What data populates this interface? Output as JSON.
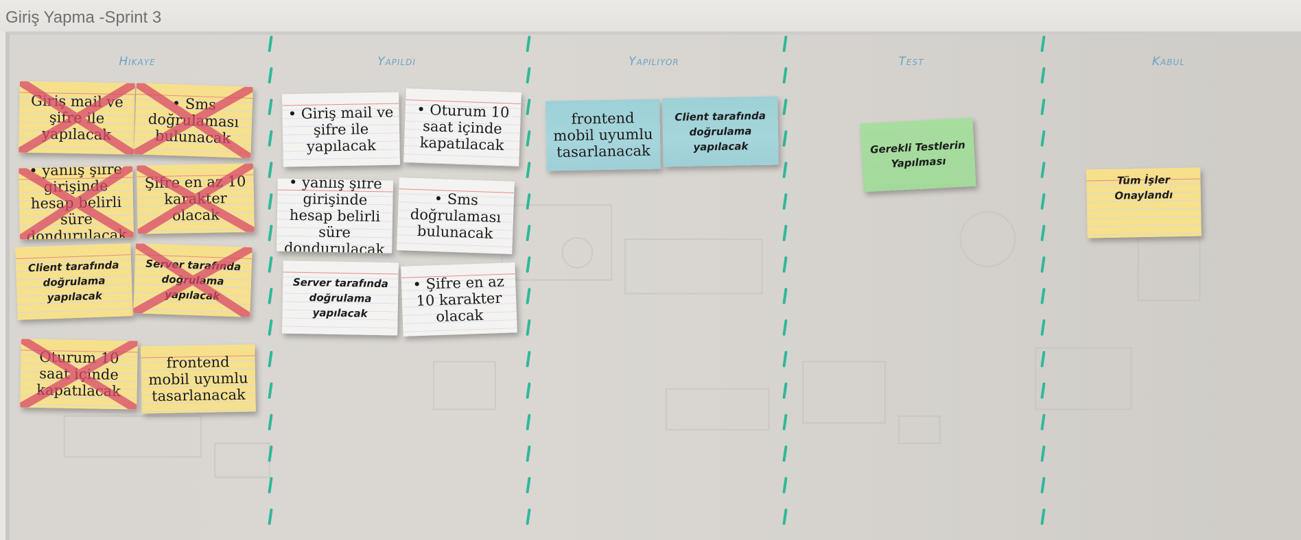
{
  "board": {
    "title": "Giriş Yapma -Sprint 3"
  },
  "columns": [
    "Hikaye",
    "Yapıldı",
    "Yapılıyor",
    "Test",
    "Kabul"
  ],
  "notes": {
    "h1": "Giriş mail ve şifre ile yapılacak",
    "h2": "• Sms doğrulaması bulunacak",
    "h3": "• yanlış şifre girişinde hesap belirli süre dondurulacak",
    "h4": "Şifre en az 10 karakter olacak",
    "h5": "Client tarafında doğrulama yapılacak",
    "h6": "Server tarafında doğrulama yapılacak",
    "h7": "Oturum 10 saat içinde kapatılacak",
    "h8": "frontend mobil uyumlu tasarlanacak",
    "d1": "• Giriş mail ve şifre ile yapılacak",
    "d2": "• Oturum 10 saat içinde kapatılacak",
    "d3": "• yanlış şifre girişinde hesap belirli süre dondurulacak",
    "d4": "• Sms doğrulaması bulunacak",
    "d5": "Server tarafında doğrulama yapılacak",
    "d6": "• Şifre en az 10 karakter olacak",
    "p1": "frontend mobil uyumlu tasarlanacak",
    "p2": "Client tarafında doğrulama yapılacak",
    "t1": "Gerekli Testlerin Yapılması",
    "k1": "Tüm İşler Onaylandı"
  },
  "colors": {
    "yellow": "#f7e08c",
    "white": "#f4f3f1",
    "teal": "#9dd0d7",
    "green": "#a7dea0",
    "cross": "#d94a6a",
    "divider": "#2fb89a",
    "heading": "#6aa3c4"
  },
  "status": {
    "crossed_out_in_hikaye": [
      "h1",
      "h2",
      "h3",
      "h4",
      "h6",
      "h7"
    ]
  }
}
